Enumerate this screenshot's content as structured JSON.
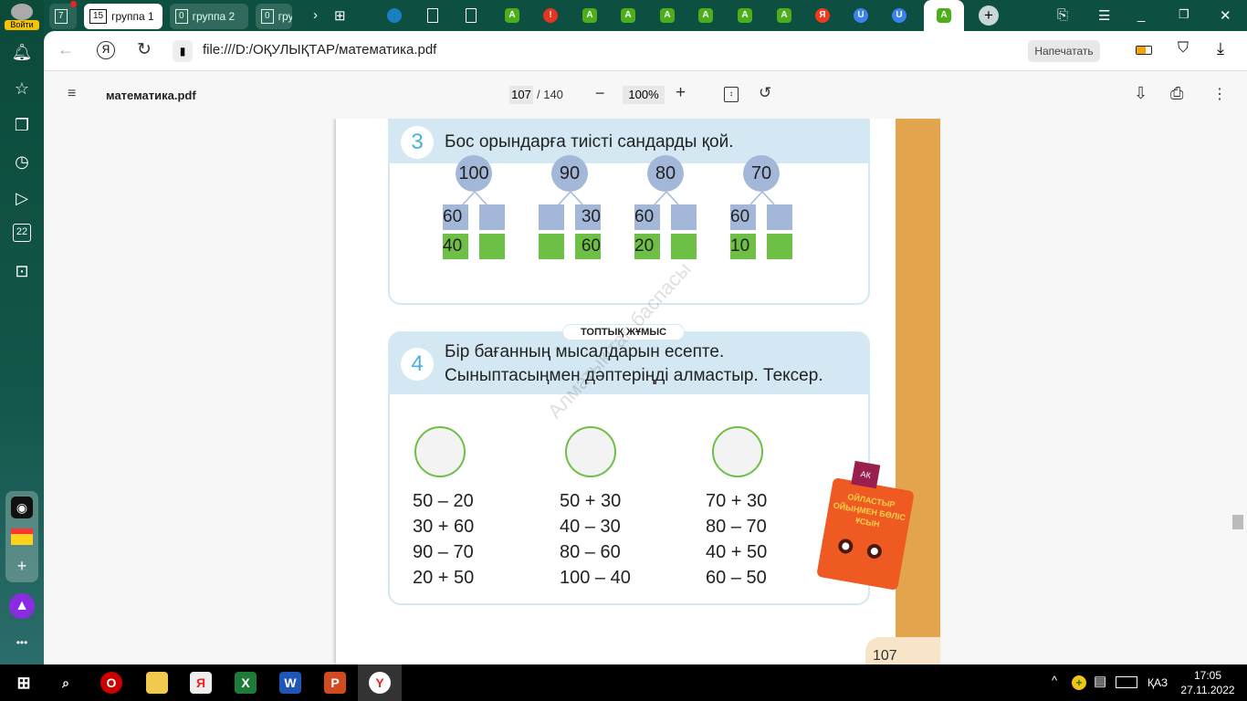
{
  "sidebar": {
    "login_label": "Войти",
    "calendar_day": "22",
    "items": [
      "bell-icon",
      "star-icon",
      "collections-icon",
      "history-icon",
      "video-icon",
      "calendar-icon",
      "screenshot-icon",
      "camera-app-icon",
      "mail-icon",
      "add-icon",
      "alice-icon",
      "more-icon"
    ]
  },
  "tabs": {
    "home_count": "7",
    "groups": [
      {
        "count": "15",
        "label": "группа 1"
      },
      {
        "count": "0",
        "label": "группа 2"
      },
      {
        "count": "0",
        "label": "груп"
      }
    ],
    "favicons": [
      {
        "glyph": "",
        "color": "#1a7fc0"
      },
      {
        "glyph": "",
        "color": "#ffffff"
      },
      {
        "glyph": "",
        "color": "#ffffff"
      },
      {
        "glyph": "A",
        "color": "#4caf1a"
      },
      {
        "glyph": "!",
        "color": "#e53422"
      },
      {
        "glyph": "A",
        "color": "#4caf1a"
      },
      {
        "glyph": "A",
        "color": "#4caf1a"
      },
      {
        "glyph": "A",
        "color": "#4caf1a"
      },
      {
        "glyph": "A",
        "color": "#4caf1a"
      },
      {
        "glyph": "A",
        "color": "#4caf1a"
      },
      {
        "glyph": "A",
        "color": "#4caf1a"
      },
      {
        "glyph": "Я",
        "color": "#f03a20"
      },
      {
        "glyph": "U",
        "color": "#3b82f0"
      },
      {
        "glyph": "U",
        "color": "#3b82f0"
      }
    ],
    "active_glyph": "A"
  },
  "address": {
    "url": "file:///D:/ОҚУЛЫҚТАР/математика.pdf",
    "print_label": "Напечатать"
  },
  "pdf": {
    "filename": "математика.pdf",
    "page": "107",
    "total": "/ 140",
    "zoom": "100%"
  },
  "page": {
    "ex3": {
      "num": "3",
      "title": "Бос орындарға тиісті сандарды қой.",
      "trees": [
        {
          "top": "100",
          "a": "60",
          "b": "",
          "c": "40",
          "d": ""
        },
        {
          "top": "90",
          "a": "",
          "b": "30",
          "c": "",
          "d": "60"
        },
        {
          "top": "80",
          "a": "60",
          "b": "",
          "c": "20",
          "d": ""
        },
        {
          "top": "70",
          "a": "60",
          "b": "",
          "c": "10",
          "d": ""
        }
      ]
    },
    "group_label": "ТОПТЫҚ ЖҰМЫС",
    "ex4": {
      "num": "4",
      "line1": "Бір бағанның мысалдарын есепте.",
      "line2": "Сыныптасыңмен дәптеріңді алмастыр. Тексер.",
      "columns": [
        [
          "50 – 20",
          "30 + 60",
          "90 – 70",
          "20 + 50"
        ],
        [
          "50 + 30",
          "40 – 30",
          "80 – 60",
          "100 – 40"
        ],
        [
          "70 + 30",
          "80 – 70",
          "40 + 50",
          "60 – 50"
        ]
      ]
    },
    "watermark": "Алматыкітап баспасы",
    "mascot": {
      "line1": "ОЙЛАСТЫР",
      "line2": "ОЙЫҢМЕН БӨЛІС",
      "line3": "ҰСЫН",
      "logo": "АК"
    },
    "page_number": "107"
  },
  "taskbar": {
    "lang": "ҚАЗ",
    "time": "17:05",
    "date": "27.11.2022"
  }
}
